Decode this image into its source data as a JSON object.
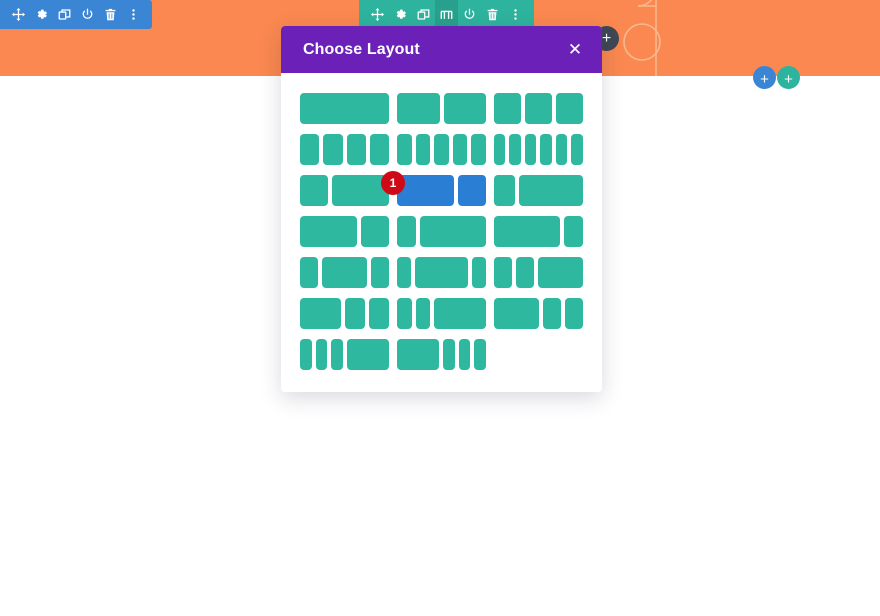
{
  "page": {
    "background_color": "#ffffff",
    "hero_band_color": "#fa8850"
  },
  "toolbars": [
    {
      "name": "section-toolbar",
      "color": "#3b86d4",
      "icons": [
        {
          "name": "move-icon",
          "label": "Move"
        },
        {
          "name": "gear-icon",
          "label": "Settings"
        },
        {
          "name": "duplicate-icon",
          "label": "Duplicate"
        },
        {
          "name": "power-icon",
          "label": "Disable"
        },
        {
          "name": "trash-icon",
          "label": "Delete"
        },
        {
          "name": "more-options-icon",
          "label": "More Options"
        }
      ]
    },
    {
      "name": "row-toolbar",
      "color": "#2eb39e",
      "icons": [
        {
          "name": "move-icon",
          "label": "Move"
        },
        {
          "name": "gear-icon",
          "label": "Settings"
        },
        {
          "name": "duplicate-icon",
          "label": "Duplicate"
        },
        {
          "name": "change-column-structure-icon",
          "label": "Change Column Structure",
          "active": true
        },
        {
          "name": "power-icon",
          "label": "Disable"
        },
        {
          "name": "trash-icon",
          "label": "Delete"
        },
        {
          "name": "more-options-icon",
          "label": "More Options"
        }
      ]
    }
  ],
  "floating_buttons": [
    {
      "name": "add-section-button",
      "glyph": "+",
      "color": "#3e4856"
    },
    {
      "name": "add-row-button-blue",
      "glyph": "+",
      "color": "#3b86d4"
    },
    {
      "name": "add-row-button-teal",
      "glyph": "+",
      "color": "#2eb39e"
    }
  ],
  "modal": {
    "title": "Choose Layout",
    "close_label": "✕",
    "header_color": "#6b21b8",
    "badge": "1",
    "column_color": "#2eb89f",
    "selected_color": "#2a7fd4",
    "layouts": [
      {
        "name": "layout-1-col",
        "widths": [
          100
        ]
      },
      {
        "name": "layout-2-col",
        "widths": [
          50,
          50
        ]
      },
      {
        "name": "layout-3-col",
        "widths": [
          33.33,
          33.33,
          33.33
        ]
      },
      {
        "name": "layout-4-col",
        "widths": [
          25,
          25,
          25,
          25
        ]
      },
      {
        "name": "layout-5-col",
        "widths": [
          20,
          20,
          20,
          20,
          20
        ]
      },
      {
        "name": "layout-6-col",
        "widths": [
          16.66,
          16.66,
          16.66,
          16.66,
          16.66,
          16.66
        ]
      },
      {
        "name": "layout-third-twothirds",
        "widths": [
          33.33,
          66.66
        ]
      },
      {
        "name": "layout-twothirds-third",
        "widths": [
          66.66,
          33.33
        ],
        "selected": true,
        "badge": "1"
      },
      {
        "name": "layout-quarter-threequarters",
        "widths": [
          25,
          75
        ]
      },
      {
        "name": "layout-twothirds-third-b",
        "widths": [
          66.66,
          33.33
        ]
      },
      {
        "name": "layout-quarter-rest",
        "widths": [
          22,
          78
        ]
      },
      {
        "name": "layout-threequarters-quarter",
        "widths": [
          78,
          22
        ]
      },
      {
        "name": "layout-quarter-half-quarter",
        "widths": [
          22,
          56,
          22
        ]
      },
      {
        "name": "layout-fifth-rest-fifth",
        "widths": [
          17,
          66,
          17
        ]
      },
      {
        "name": "layout-quarter-quarter-half",
        "widths": [
          22,
          22,
          56
        ]
      },
      {
        "name": "layout-half-quarter-quarter",
        "widths": [
          50,
          25,
          25
        ]
      },
      {
        "name": "layout-quarter-quarter-half-b",
        "widths": [
          18,
          18,
          64
        ]
      },
      {
        "name": "layout-half-quarter-quarter-b",
        "widths": [
          56,
          22,
          22
        ]
      },
      {
        "name": "layout-fifth-fifth-fifth-rest",
        "widths": [
          15,
          15,
          15,
          55
        ]
      },
      {
        "name": "layout-rest-fifth-fifth-fifth",
        "widths": [
          55,
          15,
          15,
          15
        ]
      }
    ]
  }
}
